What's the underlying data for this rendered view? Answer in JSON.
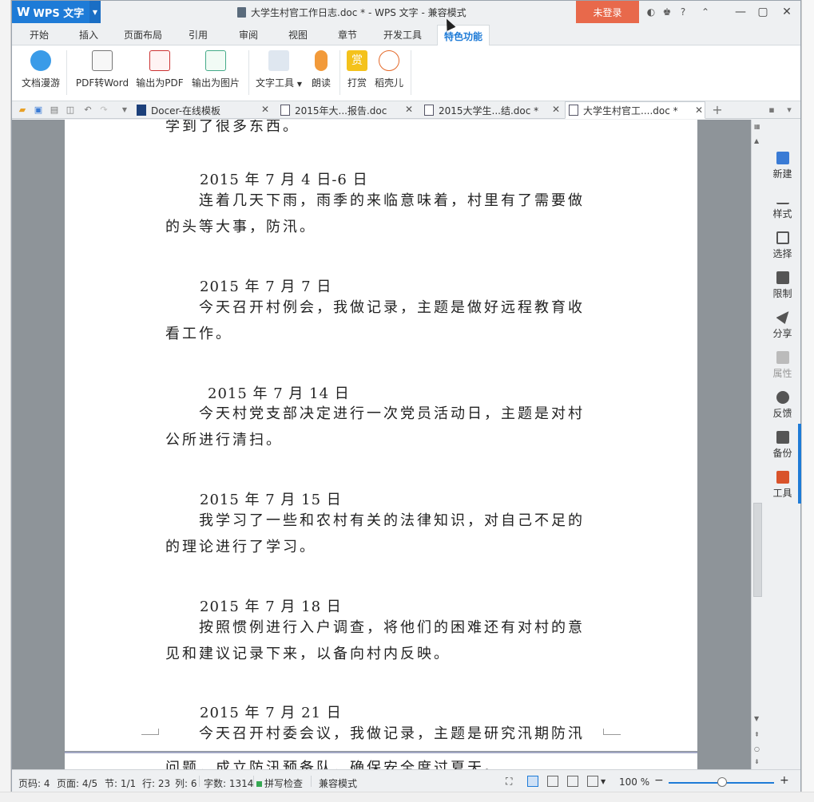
{
  "app": {
    "name": "WPS 文字",
    "window_title": "大学生村官工作日志.doc * - WPS 文字 - 兼容模式",
    "login_label": "未登录",
    "title_help": "?"
  },
  "menu": {
    "tabs": [
      "开始",
      "插入",
      "页面布局",
      "引用",
      "审阅",
      "视图",
      "章节",
      "开发工具",
      "特色功能"
    ],
    "active": "特色功能"
  },
  "ribbon": {
    "buttons": [
      {
        "label": "文档漫游",
        "icon": "cloud-icon"
      },
      {
        "label": "PDF转Word",
        "icon": "pdf-to-word-icon"
      },
      {
        "label": "输出为PDF",
        "icon": "export-pdf-icon"
      },
      {
        "label": "输出为图片",
        "icon": "export-image-icon"
      },
      {
        "label": "文字工具",
        "icon": "text-tools-icon"
      },
      {
        "label": "朗读",
        "icon": "microphone-icon"
      },
      {
        "label": "打赏",
        "icon": "reward-icon"
      },
      {
        "label": "稻壳儿",
        "icon": "docer-icon"
      }
    ],
    "reward_glyph": "赏"
  },
  "doc_tabs": [
    {
      "label": "Docer-在线模板"
    },
    {
      "label": "2015年大...报告.doc"
    },
    {
      "label": "2015大学生...结.doc *"
    },
    {
      "label": "大学生村官工....doc *",
      "active": true
    }
  ],
  "document": {
    "top_fragment": "学到了很多东西。",
    "entries": [
      {
        "date": "2015 年 7 月 4 日-6 日",
        "lines": [
          "连着几天下雨，雨季的来临意味着，村里有了需要做",
          "的头等大事，防汛。"
        ]
      },
      {
        "date": "2015 年 7 月 7 日",
        "lines": [
          "今天召开村例会，我做记录，主题是做好远程教育收",
          "看工作。"
        ]
      },
      {
        "date": "2015 年 7 月 14 日",
        "lines": [
          "今天村党支部决定进行一次党员活动日，主题是对村",
          "公所进行清扫。"
        ]
      },
      {
        "date": "2015 年 7 月 15 日",
        "lines": [
          "我学习了一些和农村有关的法律知识，对自己不足的",
          "的理论进行了学习。"
        ]
      },
      {
        "date": "2015 年 7 月 18 日",
        "lines": [
          "按照惯例进行入户调查，将他们的困难还有对村的意",
          "见和建议记录下来，以备向村内反映。"
        ]
      },
      {
        "date": "2015 年 7 月 21 日",
        "lines": [
          "今天召开村委会议，我做记录，主题是研究汛期防汛",
          "问题，成立防汛预备队，确保安全度过夏天。"
        ]
      }
    ]
  },
  "side_pane": {
    "items": [
      {
        "label": "新建",
        "icon": "new-doc-icon",
        "enabled": true
      },
      {
        "label": "样式",
        "icon": "style-icon",
        "enabled": true
      },
      {
        "label": "选择",
        "icon": "select-icon",
        "enabled": true
      },
      {
        "label": "限制",
        "icon": "lock-icon",
        "enabled": true
      },
      {
        "label": "分享",
        "icon": "share-icon",
        "enabled": true
      },
      {
        "label": "属性",
        "icon": "properties-icon",
        "enabled": false
      },
      {
        "label": "反馈",
        "icon": "feedback-icon",
        "enabled": true
      },
      {
        "label": "备份",
        "icon": "backup-icon",
        "enabled": true
      },
      {
        "label": "工具",
        "icon": "toolbox-icon",
        "enabled": true
      }
    ]
  },
  "status": {
    "page_num": "页码: 4",
    "page_of": "页面: 4/5",
    "section": "节: 1/1",
    "row": "行: 23",
    "col": "列: 6",
    "word_count": "字数: 1314",
    "spell_check": "拼写检查",
    "compat_mode": "兼容模式",
    "zoom": "100 %"
  },
  "colors": {
    "accent": "#1e7bd7",
    "login_bg": "#e8694b",
    "canvas_bg": "#8e9499"
  }
}
